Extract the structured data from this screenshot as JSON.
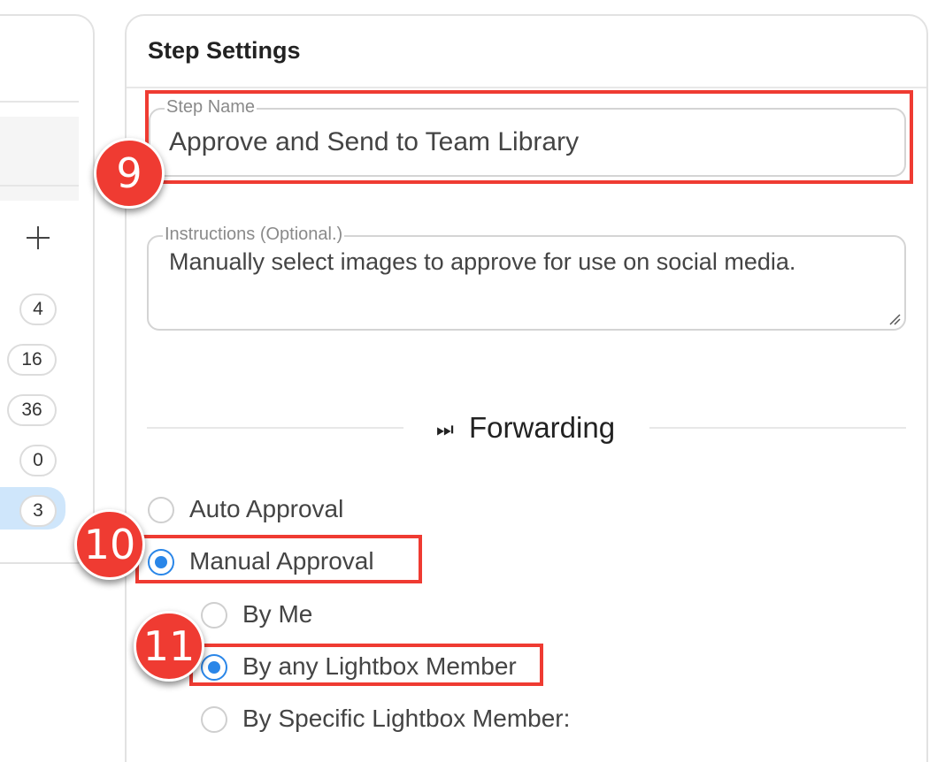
{
  "left_panel": {
    "counts": [
      "4",
      "16",
      "36",
      "0",
      "3"
    ]
  },
  "step_settings": {
    "title": "Step Settings",
    "step_name": {
      "label": "Step Name",
      "value": "Approve and Send to Team Library"
    },
    "instructions": {
      "label": "Instructions (Optional.)",
      "value": "Manually select images to approve for use on social media."
    },
    "forwarding": {
      "icon": "⏭",
      "label": "Forwarding",
      "approval_options": [
        {
          "label": "Auto Approval",
          "checked": false
        },
        {
          "label": "Manual Approval",
          "checked": true
        }
      ],
      "manual_options": [
        {
          "label": "By Me",
          "checked": false
        },
        {
          "label": "By any Lightbox Member",
          "checked": true
        },
        {
          "label": "By Specific Lightbox Member:",
          "checked": false
        }
      ]
    }
  },
  "annotations": [
    "9",
    "10",
    "11"
  ]
}
